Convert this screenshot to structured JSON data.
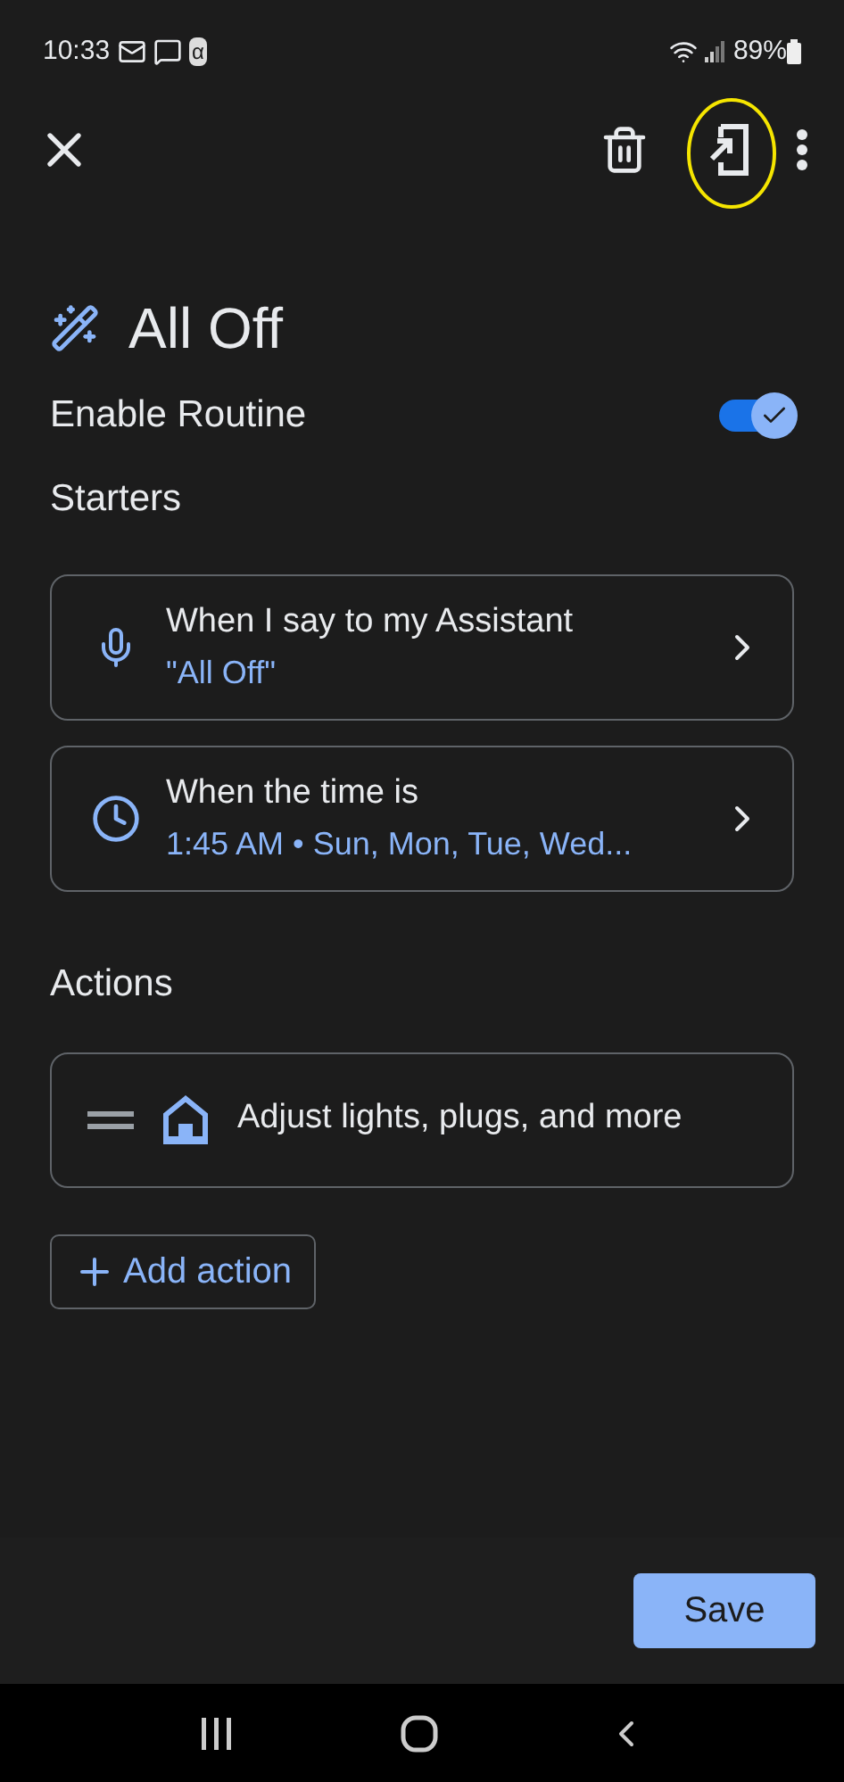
{
  "status_bar": {
    "time": "10:33",
    "notification_alpha": "α",
    "battery": "89%"
  },
  "title": "All Off",
  "enable_routine": {
    "label": "Enable Routine",
    "on": true
  },
  "starters": {
    "heading": "Starters",
    "items": [
      {
        "kind": "voice",
        "title": "When I say to my Assistant",
        "detail": "\"All Off\""
      },
      {
        "kind": "time",
        "title": "When the time is",
        "detail": "1:45 AM • Sun, Mon, Tue, Wed..."
      }
    ]
  },
  "actions": {
    "heading": "Actions",
    "items": [
      {
        "label": "Adjust lights, plugs, and more"
      }
    ],
    "add_button": "Add action"
  },
  "save_button": "Save"
}
